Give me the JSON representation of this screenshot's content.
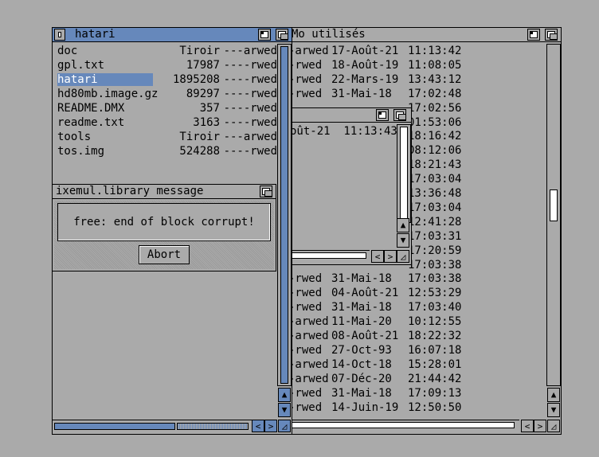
{
  "hatari_window": {
    "title": "hatari",
    "files": [
      {
        "name": "doc",
        "size": "Tiroir",
        "prot": "---arwed"
      },
      {
        "name": "gpl.txt",
        "size": "17987",
        "prot": "----rwed"
      },
      {
        "name": "hatari",
        "size": "1895208",
        "prot": "----rwed"
      },
      {
        "name": "hd80mb.image.gz",
        "size": "89297",
        "prot": "----rwed"
      },
      {
        "name": "README.DMX",
        "size": "357",
        "prot": "----rwed"
      },
      {
        "name": "readme.txt",
        "size": "3163",
        "prot": "----rwed"
      },
      {
        "name": "tools",
        "size": "Tiroir",
        "prot": "---arwed"
      },
      {
        "name": "tos.img",
        "size": "524288",
        "prot": "----rwed"
      }
    ]
  },
  "dialog": {
    "title": "ixemul.library message",
    "message": "free: end of block corrupt!",
    "abort_label": "Abort"
  },
  "right_window": {
    "title": "Mo utilisés",
    "rows": [
      {
        "p": "-arwed",
        "d": "17-Août-21",
        "t": "11:13:42"
      },
      {
        "p": "-rwed",
        "d": "18-Août-19",
        "t": "11:08:05"
      },
      {
        "p": "-rwed",
        "d": "22-Mars-19",
        "t": "13:43:12"
      },
      {
        "p": "-rwed",
        "d": "31-Mai-18",
        "t": "17:02:48"
      },
      {
        "p": "",
        "d": "",
        "t": "17:02:56"
      },
      {
        "p": "",
        "d": "",
        "t": "01:53:06"
      },
      {
        "p": "",
        "d": "",
        "t": "18:16:42"
      },
      {
        "p": "",
        "d": "",
        "t": "08:12:06"
      },
      {
        "p": "",
        "d": "",
        "t": "18:21:43"
      },
      {
        "p": "",
        "d": "",
        "t": "17:03:04"
      },
      {
        "p": "",
        "d": "",
        "t": "13:36:48"
      },
      {
        "p": "",
        "d": "",
        "t": "17:03:04"
      },
      {
        "p": "",
        "d": "",
        "t": "12:41:28"
      },
      {
        "p": "",
        "d": "",
        "t": "17:03:31"
      },
      {
        "p": "",
        "d": "",
        "t": "17:20:59"
      },
      {
        "p": "",
        "d": "",
        "t": "17:03:38"
      },
      {
        "p": "-rwed",
        "d": "31-Mai-18",
        "t": "17:03:38"
      },
      {
        "p": "-rwed",
        "d": "04-Août-21",
        "t": "12:53:29"
      },
      {
        "p": "-rwed",
        "d": "31-Mai-18",
        "t": "17:03:40"
      },
      {
        "p": "-arwed",
        "d": "11-Mai-20",
        "t": "10:12:55"
      },
      {
        "p": "-arwed",
        "d": "08-Août-21",
        "t": "18:22:32"
      },
      {
        "p": "-rwed",
        "d": "27-Oct-93",
        "t": "16:07:18"
      },
      {
        "p": "-arwed",
        "d": "14-Oct-18",
        "t": "15:28:01"
      },
      {
        "p": "-arwed",
        "d": "07-Déc-20",
        "t": "21:44:42"
      },
      {
        "p": "-rwed",
        "d": "31-Mai-18",
        "t": "17:09:13"
      },
      {
        "p": "-rwed",
        "d": "14-Juin-19",
        "t": "12:50:50"
      }
    ]
  },
  "inner_window": {
    "row_text": "oût-21  11:13:43"
  },
  "arrows": {
    "up": "▲",
    "down": "▼",
    "left": "<",
    "right": ">"
  },
  "colors": {
    "desktop": "#aaaaaa",
    "title_active": "#6688bb",
    "select": "#6688bb",
    "text": "#000000"
  }
}
